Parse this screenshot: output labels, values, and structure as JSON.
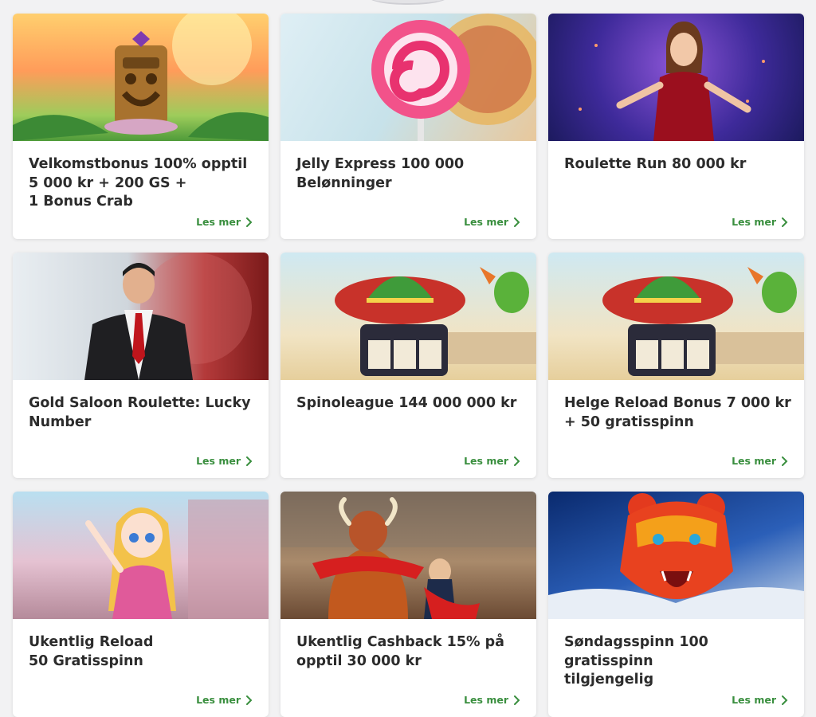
{
  "theme": {
    "link_color": "#3a8f3f",
    "title_color": "#2c2c2c",
    "background": "#f2f2f3"
  },
  "promotions": [
    {
      "title_lines": [
        "Velkomstbonus 100% opptil",
        "5 000 kr + 200 GS +",
        "1 Bonus Crab"
      ],
      "link": "Les mer"
    },
    {
      "title_lines": [
        "Jelly Express 100 000",
        "Belønninger"
      ],
      "link": "Les mer"
    },
    {
      "title_lines": [
        "Roulette Run 80 000 kr"
      ],
      "link": "Les mer"
    },
    {
      "title_lines": [
        "Gold Saloon Roulette: Lucky",
        "Number"
      ],
      "link": "Les mer"
    },
    {
      "title_lines": [
        "Spinoleague 144 000 000 kr"
      ],
      "link": "Les mer"
    },
    {
      "title_lines": [
        "Helge Reload Bonus 7 000 kr",
        "+ 50 gratisspinn"
      ],
      "link": "Les mer"
    },
    {
      "title_lines": [
        "Ukentlig Reload",
        "50 Gratisspinn"
      ],
      "link": "Les mer"
    },
    {
      "title_lines": [
        "Ukentlig Cashback 15% på",
        "opptil 30 000 kr"
      ],
      "link": "Les mer"
    },
    {
      "title_lines": [
        "Søndagsspinn 100 gratisspinn",
        "tilgjengelig"
      ],
      "link": "Les mer"
    }
  ]
}
